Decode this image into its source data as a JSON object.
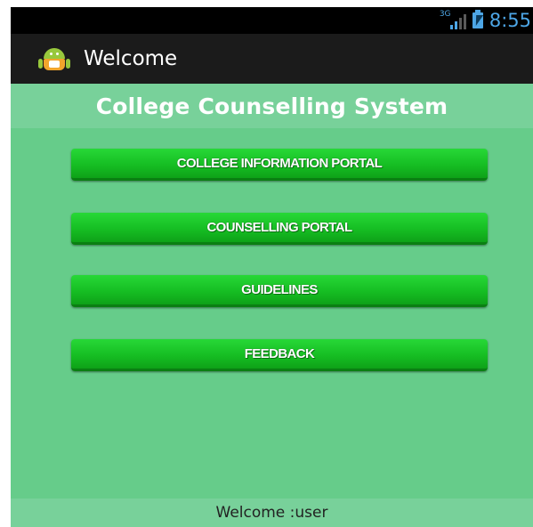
{
  "status_bar": {
    "network_label": "3G",
    "time": "8:55"
  },
  "action_bar": {
    "title": "Welcome",
    "icon": "android-icon"
  },
  "header": {
    "title": "College Counselling System"
  },
  "menu": {
    "buttons": [
      {
        "label": "COLLEGE INFORMATION PORTAL"
      },
      {
        "label": "COUNSELLING PORTAL"
      },
      {
        "label": "GUIDELINES"
      },
      {
        "label": "FEEDBACK"
      }
    ]
  },
  "footer": {
    "text": "Welcome :user"
  },
  "colors": {
    "background": "#66cc8a",
    "band": "#78d19a",
    "button": "#16be23",
    "status_accent": "#4da6e6"
  }
}
